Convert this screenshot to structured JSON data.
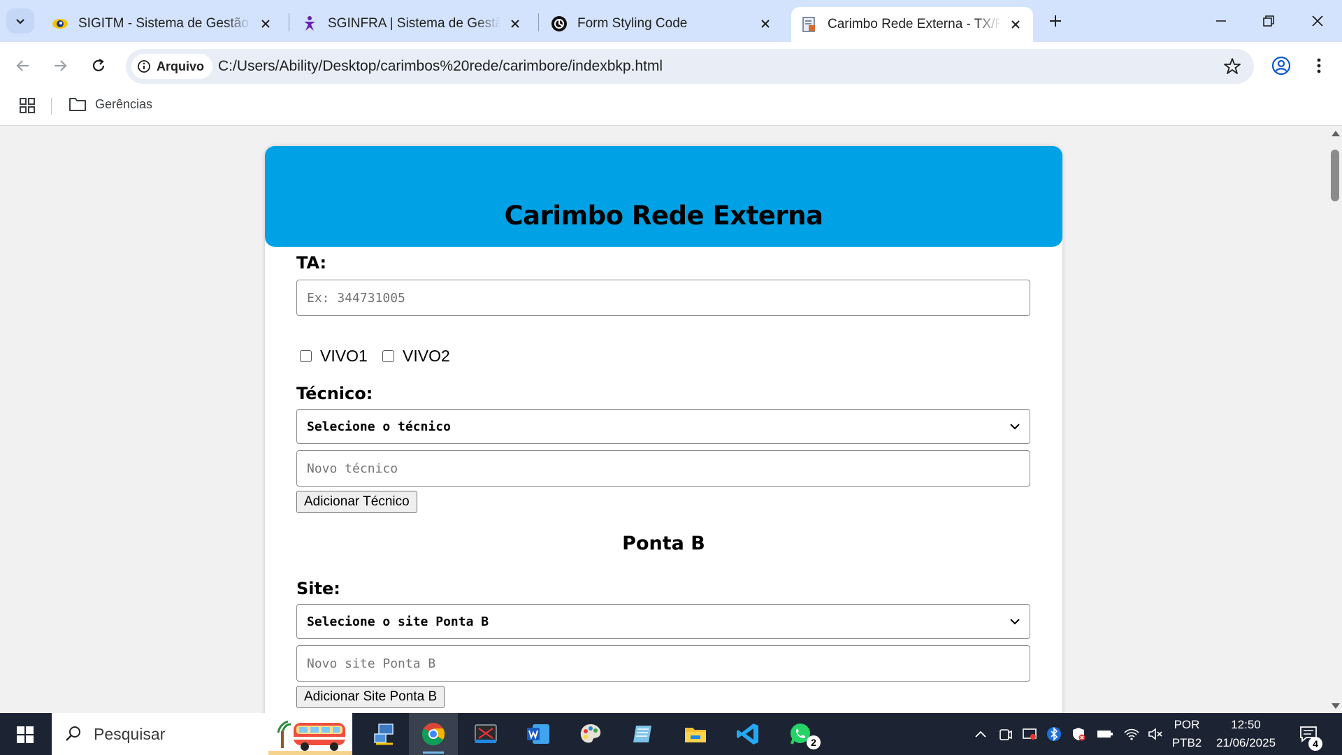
{
  "browser": {
    "tabs": [
      {
        "title": "SIGITM - Sistema de Gestão Integrado",
        "icon": "eye-globe-icon",
        "active": false
      },
      {
        "title": "SGINFRA | Sistema de Gestão de Infra",
        "icon": "purple-figure-icon",
        "active": false
      },
      {
        "title": "Form Styling Code",
        "icon": "openai-icon",
        "active": false
      },
      {
        "title": "Carimbo Rede Externa - TX/RX Rede",
        "icon": "document-stamp-icon",
        "active": true
      }
    ],
    "address": {
      "chip_label": "Arquivo",
      "url": "C:/Users/Ability/Desktop/carimbos%20rede/carimbore/indexbkp.html"
    },
    "bookmarks": [
      {
        "label": "Gerências",
        "icon": "folder-icon"
      }
    ],
    "colors": {
      "tabstrip": "#d3e3fd",
      "omnibox": "#e9eef6"
    }
  },
  "page": {
    "header_title": "Carimbo Rede Externa",
    "header_color": "#00a2e5",
    "ta": {
      "label": "TA:",
      "placeholder": "Ex: 344731005"
    },
    "checkboxes": [
      {
        "label": "VIVO1",
        "checked": false
      },
      {
        "label": "VIVO2",
        "checked": false
      }
    ],
    "tecnico": {
      "label": "Técnico:",
      "select_value": "Selecione o técnico",
      "new_placeholder": "Novo técnico",
      "add_button": "Adicionar Técnico"
    },
    "ponta_b": {
      "section_title": "Ponta B",
      "site_label": "Site:",
      "select_value": "Selecione o site Ponta B",
      "new_placeholder": "Novo site Ponta B",
      "add_button": "Adicionar Site Ponta B"
    }
  },
  "taskbar": {
    "search_text": "Pesquisar",
    "apps": [
      {
        "name": "network-app-icon"
      },
      {
        "name": "chrome-icon",
        "active": true
      },
      {
        "name": "snipping-tool-icon"
      },
      {
        "name": "word-icon"
      },
      {
        "name": "paint-icon"
      },
      {
        "name": "notepad-icon"
      },
      {
        "name": "file-explorer-icon"
      },
      {
        "name": "vscode-icon"
      },
      {
        "name": "whatsapp-icon",
        "badge": "2"
      }
    ],
    "language": {
      "line1": "POR",
      "line2": "PTB2"
    },
    "clock": {
      "time": "12:50",
      "date": "21/06/2025"
    },
    "notifications": "4"
  }
}
